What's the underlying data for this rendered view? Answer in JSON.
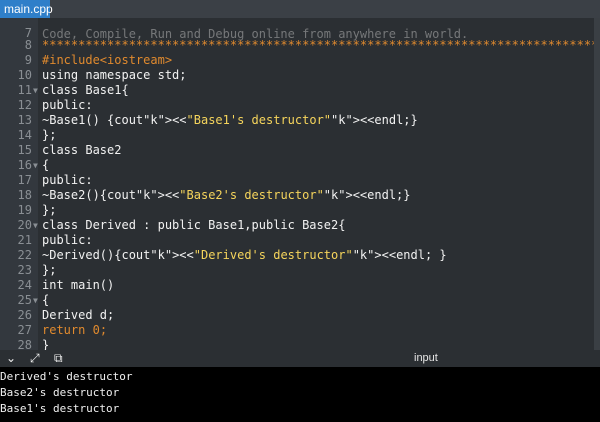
{
  "tab": {
    "label": "main.cpp"
  },
  "editor": {
    "faded_top": "Code, Compile, Run and Debug online from anywhere in world.",
    "lines": [
      {
        "n": "7",
        "code": ""
      },
      {
        "n": "8",
        "code": "*******************************************************************************/"
      },
      {
        "n": "9",
        "code": "#include<iostream>"
      },
      {
        "n": "10",
        "code": "using namespace std;"
      },
      {
        "n": "11",
        "code": "class Base1{"
      },
      {
        "n": "12",
        "code": "public:"
      },
      {
        "n": "13",
        "code": "~Base1() {cout<<\"Base1's destructor\"<<endl;}"
      },
      {
        "n": "14",
        "code": "};"
      },
      {
        "n": "15",
        "code": "class Base2"
      },
      {
        "n": "16",
        "code": "{"
      },
      {
        "n": "17",
        "code": "public:"
      },
      {
        "n": "18",
        "code": "~Base2(){cout<<\"Base2's destructor\"<<endl;}"
      },
      {
        "n": "19",
        "code": "};"
      },
      {
        "n": "20",
        "code": "class Derived : public Base1,public Base2{"
      },
      {
        "n": "21",
        "code": "public:"
      },
      {
        "n": "22",
        "code": "~Derived(){cout<<\"Derived's destructor\"<<endl; }"
      },
      {
        "n": "23",
        "code": "};"
      },
      {
        "n": "24",
        "code": "int main()"
      },
      {
        "n": "25",
        "code": "{"
      },
      {
        "n": "26",
        "code": "Derived d;"
      },
      {
        "n": "27",
        "code": "return 0;"
      },
      {
        "n": "28",
        "code": "}"
      }
    ]
  },
  "toolbar": {
    "collapse_icon": "chevron-down-icon",
    "expand_icon": "expand-icon",
    "copy_icon": "copy-icon",
    "input_label": "input"
  },
  "console": {
    "output": [
      "Derived's destructor",
      "Base2's destructor",
      "Base1's destructor"
    ]
  }
}
